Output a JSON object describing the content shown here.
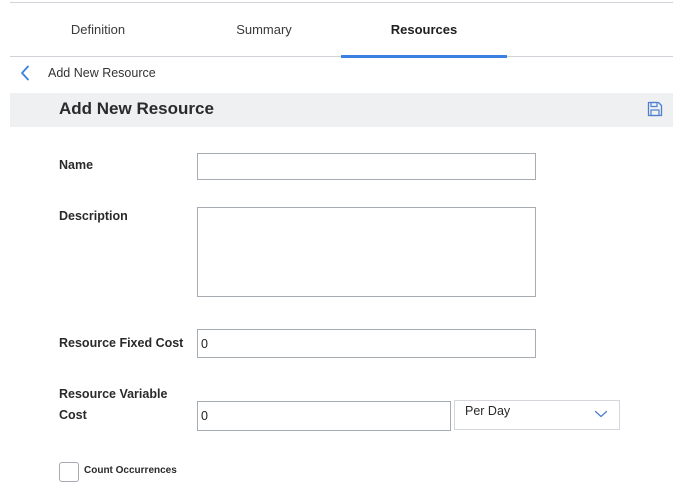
{
  "tabs": [
    {
      "label": "Definition",
      "active": false
    },
    {
      "label": "Summary",
      "active": false
    },
    {
      "label": "Resources",
      "active": true
    }
  ],
  "breadcrumb": {
    "label": "Add New Resource",
    "icon": "chevron-left-icon"
  },
  "header": {
    "title": "Add New Resource",
    "save_icon": "save-icon"
  },
  "form": {
    "name": {
      "label": "Name",
      "value": ""
    },
    "description": {
      "label": "Description",
      "value": ""
    },
    "fixed_cost": {
      "label": "Resource Fixed Cost",
      "value": "0"
    },
    "variable_cost": {
      "label_line1": "Resource Variable",
      "label_line2": "Cost",
      "value": "0",
      "unit": "Per Day"
    },
    "count_occurrences": {
      "label": "Count Occurrences",
      "checked": false
    }
  },
  "colors": {
    "accent": "#3b7fe0",
    "header_bg": "#eef0f2",
    "border": "#a7acb2"
  }
}
